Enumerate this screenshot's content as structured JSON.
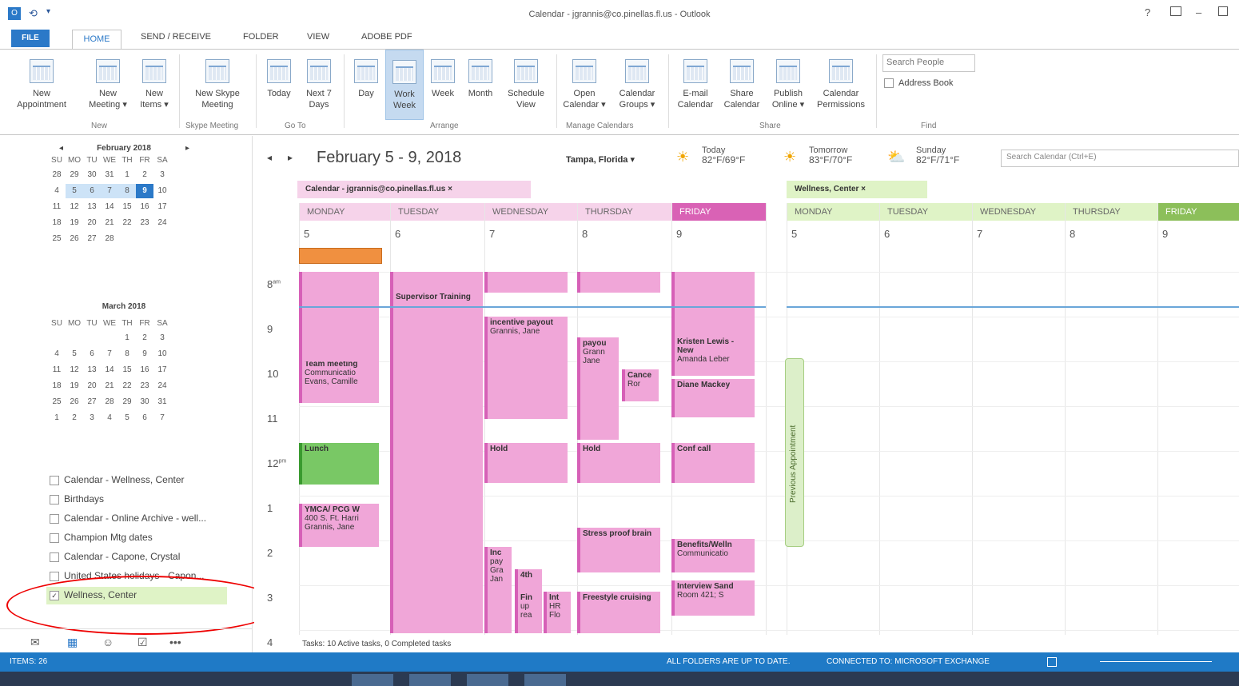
{
  "window": {
    "title": "Calendar - jgrannis@co.pinellas.fl.us - Outlook",
    "help": "?",
    "minimize": "–"
  },
  "quickaccess": [
    "O",
    "⟲",
    "▾"
  ],
  "tabs": [
    "FILE",
    "HOME",
    "SEND / RECEIVE",
    "FOLDER",
    "VIEW",
    "ADOBE PDF"
  ],
  "ribbon": {
    "buttons": [
      {
        "label": "New\nAppointment",
        "name": "new-appointment-button"
      },
      {
        "label": "New\nMeeting ▾",
        "name": "new-meeting-button"
      },
      {
        "label": "New\nItems ▾",
        "name": "new-items-button"
      },
      {
        "label": "New Skype\nMeeting",
        "name": "new-skype-meeting-button"
      },
      {
        "label": "Today",
        "name": "today-button"
      },
      {
        "label": "Next 7\nDays",
        "name": "next-7-days-button"
      },
      {
        "label": "Day",
        "name": "day-view-button"
      },
      {
        "label": "Work\nWeek",
        "name": "work-week-button"
      },
      {
        "label": "Week",
        "name": "week-view-button"
      },
      {
        "label": "Month",
        "name": "month-view-button"
      },
      {
        "label": "Schedule\nView",
        "name": "schedule-view-button"
      },
      {
        "label": "Open\nCalendar ▾",
        "name": "open-calendar-button"
      },
      {
        "label": "Calendar\nGroups ▾",
        "name": "calendar-groups-button"
      },
      {
        "label": "E-mail\nCalendar",
        "name": "email-calendar-button"
      },
      {
        "label": "Share\nCalendar",
        "name": "share-calendar-button"
      },
      {
        "label": "Publish\nOnline ▾",
        "name": "publish-online-button"
      },
      {
        "label": "Calendar\nPermissions",
        "name": "calendar-permissions-button"
      }
    ],
    "groups": [
      "New",
      "Skype Meeting",
      "Go To",
      "Arrange",
      "Manage Calendars",
      "Share",
      "Find"
    ],
    "search_people": "Search People",
    "address_book": "Address Book"
  },
  "mini_feb": {
    "title": "February 2018",
    "days": [
      "SU",
      "MO",
      "TU",
      "WE",
      "TH",
      "FR",
      "SA"
    ],
    "rows": [
      [
        "28",
        "29",
        "30",
        "31",
        "1",
        "2",
        "3"
      ],
      [
        "4",
        "5",
        "6",
        "7",
        "8",
        "9",
        "10"
      ],
      [
        "11",
        "12",
        "13",
        "14",
        "15",
        "16",
        "17"
      ],
      [
        "18",
        "19",
        "20",
        "21",
        "22",
        "23",
        "24"
      ],
      [
        "25",
        "26",
        "27",
        "28",
        "",
        "",
        ""
      ]
    ]
  },
  "mini_mar": {
    "title": "March 2018",
    "days": [
      "SU",
      "MO",
      "TU",
      "WE",
      "TH",
      "FR",
      "SA"
    ],
    "rows": [
      [
        "",
        "",
        "",
        "",
        "1",
        "2",
        "3"
      ],
      [
        "4",
        "5",
        "6",
        "7",
        "8",
        "9",
        "10"
      ],
      [
        "11",
        "12",
        "13",
        "14",
        "15",
        "16",
        "17"
      ],
      [
        "18",
        "19",
        "20",
        "21",
        "22",
        "23",
        "24"
      ],
      [
        "25",
        "26",
        "27",
        "28",
        "29",
        "30",
        "31"
      ],
      [
        "1",
        "2",
        "3",
        "4",
        "5",
        "6",
        "7"
      ]
    ]
  },
  "calendars": [
    "Calendar - Wellness, Center",
    "Birthdays",
    "Calendar - Online Archive - well...",
    "Champion Mtg dates",
    "Calendar - Capone, Crystal",
    "United States holidays - Capon...",
    "Wellness, Center"
  ],
  "header": {
    "range": "February 5 - 9, 2018",
    "location": "Tampa, Florida ▾",
    "weather": [
      {
        "day": "Today",
        "temp": "82°F/69°F"
      },
      {
        "day": "Tomorrow",
        "temp": "83°F/70°F"
      },
      {
        "day": "Sunday",
        "temp": "82°F/71°F"
      }
    ],
    "search": "Search Calendar (Ctrl+E)"
  },
  "tab1": "Calendar - jgrannis@co.pinellas.fl.us  ×",
  "tab2": "Wellness, Center  ×",
  "days": [
    "MONDAY",
    "TUESDAY",
    "WEDNESDAY",
    "THURSDAY",
    "FRIDAY"
  ],
  "dates": [
    "5",
    "6",
    "7",
    "8",
    "9"
  ],
  "hours": [
    "8",
    "9",
    "10",
    "11",
    "12",
    "1",
    "2",
    "3",
    "4"
  ],
  "ampm": [
    "am",
    "pm"
  ],
  "events": [
    {
      "t": "Supervisor Training",
      "s": ""
    },
    {
      "t": "incentive payout",
      "s": "Grannis, Jane"
    },
    {
      "t": "payou",
      "s": "Grann Jane"
    },
    {
      "t": "Cance",
      "s": "Ror"
    },
    {
      "t": "Kristen Lewis - New",
      "s": "Amanda Leber"
    },
    {
      "t": "Diane Mackey",
      "s": ""
    },
    {
      "t": "Team meeting",
      "s": "Communicatio Evans, Camille"
    },
    {
      "t": "Lunch",
      "s": ""
    },
    {
      "t": "Hold",
      "s": ""
    },
    {
      "t": "Hold",
      "s": ""
    },
    {
      "t": "Conf call",
      "s": ""
    },
    {
      "t": "YMCA/ PCG W",
      "s": "400 S. Ft. Harri Grannis, Jane"
    },
    {
      "t": "Stress proof brain",
      "s": ""
    },
    {
      "t": "Benefits/Welln",
      "s": "Communicatio"
    },
    {
      "t": "Inc",
      "s": "pay Gra Jan"
    },
    {
      "t": "4th",
      "s": ""
    },
    {
      "t": "Fin",
      "s": "up rea"
    },
    {
      "t": "Int",
      "s": "HR Flo"
    },
    {
      "t": "Freestyle cruising",
      "s": ""
    },
    {
      "t": "Interview Sand",
      "s": "Room 421; S"
    }
  ],
  "tasks": "Tasks: 10 Active tasks, 0 Completed tasks",
  "prev_appt": "Previous Appointment",
  "status": {
    "items": "ITEMS: 26",
    "sync": "ALL FOLDERS ARE UP TO DATE.",
    "conn": "CONNECTED TO: MICROSOFT EXCHANGE"
  }
}
